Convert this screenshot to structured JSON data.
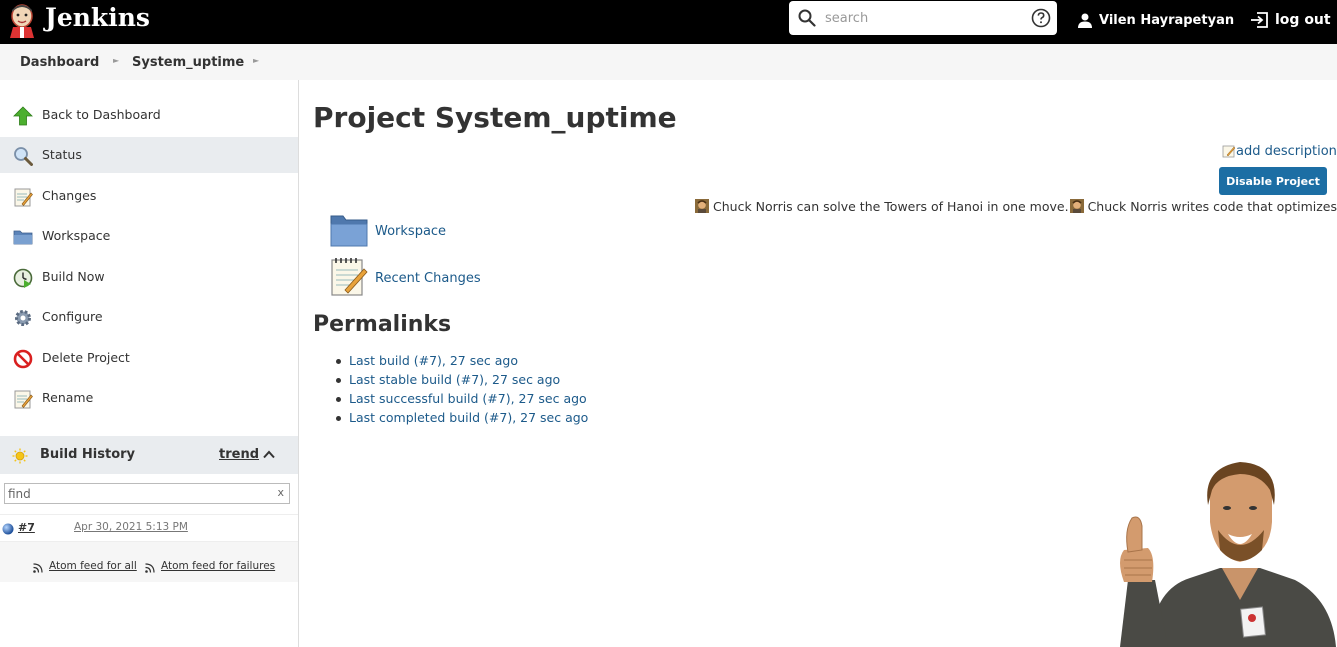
{
  "header": {
    "brand": "Jenkins",
    "search_placeholder": "search",
    "user_name": "Vilen Hayrapetyan",
    "logout_label": "log out"
  },
  "breadcrumb": {
    "items": [
      "Dashboard",
      "System_uptime"
    ]
  },
  "sidebar": {
    "tasks": [
      {
        "label": "Back to Dashboard",
        "icon": "up-arrow-icon"
      },
      {
        "label": "Status",
        "icon": "magnifier-icon"
      },
      {
        "label": "Changes",
        "icon": "notepad-icon"
      },
      {
        "label": "Workspace",
        "icon": "folder-icon"
      },
      {
        "label": "Build Now",
        "icon": "clock-play-icon"
      },
      {
        "label": "Configure",
        "icon": "gear-icon"
      },
      {
        "label": "Delete Project",
        "icon": "no-entry-icon"
      },
      {
        "label": "Rename",
        "icon": "notepad-icon"
      }
    ],
    "active_task": "Status",
    "build_history": {
      "title": "Build History",
      "trend_label": "trend",
      "find_placeholder": "find",
      "clear_label": "x",
      "builds": [
        {
          "number": "#7",
          "date": "Apr 30, 2021 5:13 PM",
          "status": "blue-ball"
        }
      ],
      "feed_all": "Atom feed for all",
      "feed_failures": "Atom feed for failures"
    }
  },
  "main": {
    "title": "Project System_uptime",
    "add_description": "add description",
    "disable_button": "Disable Project",
    "facts": [
      "Chuck Norris can solve the Towers of Hanoi in one move.",
      "Chuck Norris writes code that optimizes itself."
    ],
    "links": [
      {
        "label": "Workspace",
        "icon": "folder-icon"
      },
      {
        "label": "Recent Changes",
        "icon": "notepad-icon"
      }
    ],
    "permalinks_title": "Permalinks",
    "permalinks": [
      "Last build (#7), 27 sec ago",
      "Last stable build (#7), 27 sec ago",
      "Last successful build (#7), 27 sec ago",
      "Last completed build (#7), 27 sec ago"
    ]
  },
  "colors": {
    "header_bg": "#000000",
    "link": "#1c5a8a",
    "button": "#1c6ea4",
    "active_bg": "#e9ecef"
  }
}
